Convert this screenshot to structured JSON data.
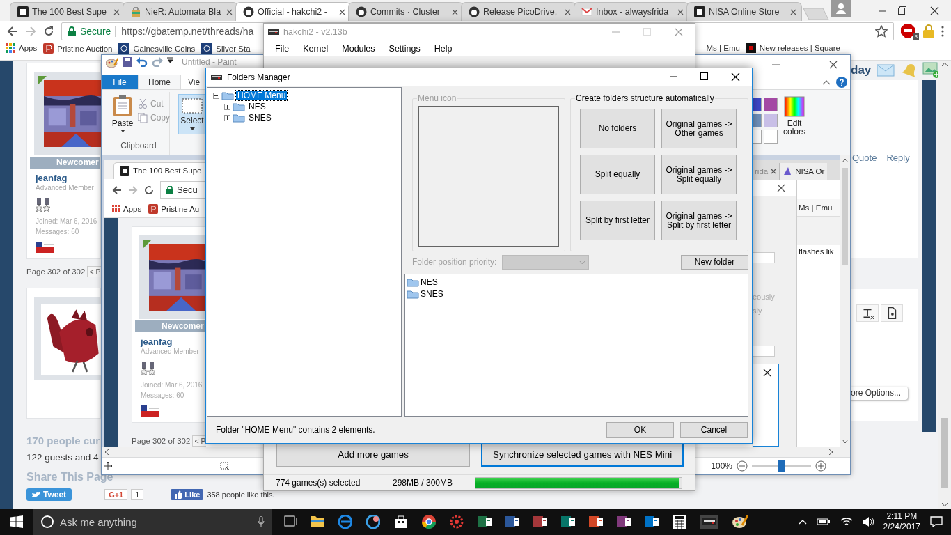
{
  "browser": {
    "tabs": [
      {
        "label": "The 100 Best Supe",
        "selected": false
      },
      {
        "label": "NieR: Automata Bla",
        "selected": false
      },
      {
        "label": "Official - hakchi2 -",
        "selected": true
      },
      {
        "label": "Commits · Cluster",
        "selected": false
      },
      {
        "label": "Release PicoDrive,",
        "selected": false
      },
      {
        "label": "Inbox - alwaysfrida",
        "selected": false
      },
      {
        "label": "NISA Online Store",
        "selected": false
      }
    ],
    "address": {
      "secure": "Secure",
      "url": "https://gbatemp.net/threads/ha"
    },
    "extension_badge": "3",
    "bookmarks_left": [
      "Apps",
      "Pristine Auction",
      "Gainesville Coins",
      "Silver Sta"
    ],
    "bookmarks_right": [
      "Ms | Emu",
      "New releases | Square"
    ],
    "page": {
      "post": {
        "rank": "Newcomer",
        "username": "jeanfag",
        "user_title": "Advanced Member",
        "joined": "Joined: Mar 6, 2016",
        "messages": "Messages: 60"
      },
      "pager": {
        "label": "Page 302 of 302",
        "button": "< P"
      },
      "online_title": "170 people cur",
      "online_detail": "122 guests and 4",
      "share_title": "Share This Page",
      "share": {
        "tweet": "Tweet",
        "gplus": "G+1",
        "gplus_count": "1",
        "like": "Like",
        "like_text": "358 people like this."
      },
      "header_text": "day",
      "post_links": [
        "Quote",
        "Reply"
      ],
      "more_options": "ore Options..."
    }
  },
  "paint": {
    "title": "Untitled - Paint",
    "file_tab": "File",
    "tabs": [
      {
        "label": "Home",
        "selected": true
      },
      {
        "label": "Vie",
        "selected": false
      }
    ],
    "clipboard": {
      "paste": "Paste",
      "cut": {
        "label": "Cut",
        "disabled": true
      },
      "copy": {
        "label": "Copy",
        "disabled": true
      },
      "group": "Clipboard"
    },
    "select": {
      "label": "Select",
      "selected": true
    },
    "palette": [
      {
        "color": "#3f48cc"
      },
      {
        "color": "#a349a4"
      },
      {
        "color": "#7092be"
      },
      {
        "color": "#c8bfe7"
      },
      {
        "color": "#ffffff"
      },
      {
        "color": "#ffffff"
      }
    ],
    "edit_colors": "Edit colors",
    "zoom": {
      "reading": "100%",
      "level": 0.5
    },
    "canvas": {
      "tab": "The 100 Best Supe",
      "secure": "Secu",
      "bookmarks": [
        "Apps",
        "Pristine Au"
      ],
      "post": {
        "rank": "Newcomer",
        "username": "jeanfag",
        "user_title": "Advanced Member",
        "joined": "Joined: Mar 6, 2016",
        "messages": "Messages: 60"
      },
      "pager": {
        "label": "Page 302 of 302",
        "button": "< P"
      },
      "right_tabs": [
        "rida",
        "NISA Or"
      ],
      "bookmark_right": "Ms | Emu",
      "snippet": "flashes lik",
      "dialog_lines": [
        "eously",
        "sly"
      ]
    }
  },
  "hakchi": {
    "title": "hakchi2 - v2.13b",
    "menu": [
      "File",
      "Kernel",
      "Modules",
      "Settings",
      "Help"
    ],
    "buttons": [
      {
        "label": "Add more games",
        "focused": false
      },
      {
        "label": "Synchronize selected games with NES Mini",
        "focused": true
      }
    ],
    "status": {
      "selected": "774 games(s) selected",
      "size": "298MB / 300MB",
      "level": 0.99
    }
  },
  "folders_manager": {
    "title": "Folders Manager",
    "tree": [
      {
        "label": "HOME Menu",
        "selected": true,
        "expanded": true,
        "children": [
          {
            "label": "NES",
            "selected": false,
            "expanded": false
          },
          {
            "label": "SNES",
            "selected": false,
            "expanded": false
          }
        ]
      }
    ],
    "menu_icon": {
      "label": "Menu icon",
      "disabled": true
    },
    "auto": {
      "label": "Create folders structure automatically",
      "buttons": [
        "No folders",
        "Original games ->\nOther games",
        "Split equally",
        "Original games ->\nSplit equally",
        "Split by first letter",
        "Original games ->\nSplit by first letter"
      ]
    },
    "position": {
      "label": "Folder position priority:",
      "disabled": true
    },
    "new_folder": "New folder",
    "items": [
      "NES",
      "SNES"
    ],
    "status": "Folder \"HOME Menu\" contains 2 elements.",
    "ok": "OK",
    "cancel": "Cancel"
  },
  "taskbar": {
    "search": "Ask me anything",
    "time": "2:11 PM",
    "date": "2/24/2017"
  }
}
